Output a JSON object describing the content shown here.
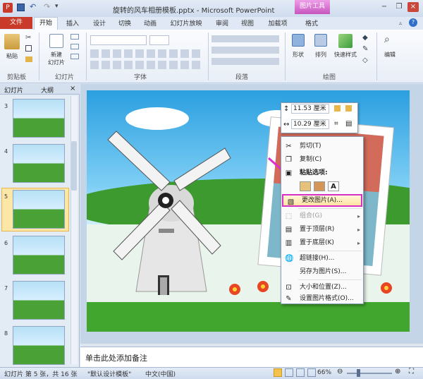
{
  "titlebar": {
    "title": "旋转的风车相册模板.pptx - Microsoft PowerPoint",
    "contextual_tab": "图片工具"
  },
  "tabs": [
    "文件",
    "开始",
    "插入",
    "设计",
    "切换",
    "动画",
    "幻灯片放映",
    "审阅",
    "视图",
    "加载项",
    "格式"
  ],
  "ribbon": {
    "groups": [
      "剪贴板",
      "幻灯片",
      "字体",
      "段落",
      "绘图"
    ],
    "paste": "粘贴",
    "new_slide": "新建\n幻灯片",
    "shape": "形状",
    "arrange": "排列",
    "quick_styles": "快速样式",
    "editing": "编辑"
  },
  "left_pane": {
    "tabs": [
      "幻灯片",
      "大纲"
    ],
    "close": "×",
    "slide_numbers": [
      "3",
      "4",
      "5",
      "6",
      "7",
      "8"
    ],
    "selected_index": 2
  },
  "size_box": {
    "height": "11.53 厘米",
    "width": "10.29 厘米"
  },
  "context_menu": [
    {
      "label": "剪切(T)",
      "icon": "cut-icon"
    },
    {
      "label": "复制(C)",
      "icon": "copy-icon"
    },
    {
      "label": "粘贴选项:",
      "icon": "paste-icon",
      "bold": true
    },
    {
      "label": "更改图片(A)...",
      "icon": "change-picture-icon",
      "highlight": true
    },
    {
      "label": "组合(G)",
      "icon": "group-icon",
      "disabled": true,
      "submenu": true
    },
    {
      "label": "置于顶层(R)",
      "icon": "bring-front-icon",
      "submenu": true
    },
    {
      "label": "置于底层(K)",
      "icon": "send-back-icon",
      "submenu": true
    },
    {
      "label": "超链接(H)...",
      "icon": "hyperlink-icon"
    },
    {
      "label": "另存为图片(S)...",
      "icon": "save-picture-icon"
    },
    {
      "label": "大小和位置(Z)...",
      "icon": "size-position-icon"
    },
    {
      "label": "设置图片格式(O)...",
      "icon": "format-picture-icon"
    }
  ],
  "notes_placeholder": "单击此处添加备注",
  "status": {
    "slide_info": "幻灯片 第 5 张，共 16 张",
    "theme": "\"默认设计模板\"",
    "language": "中文(中国)",
    "zoom": "66%"
  },
  "colors": {
    "accent_file": "#c93a2a",
    "highlight_border": "#d52fc6",
    "arrow": "#e02bd0"
  }
}
